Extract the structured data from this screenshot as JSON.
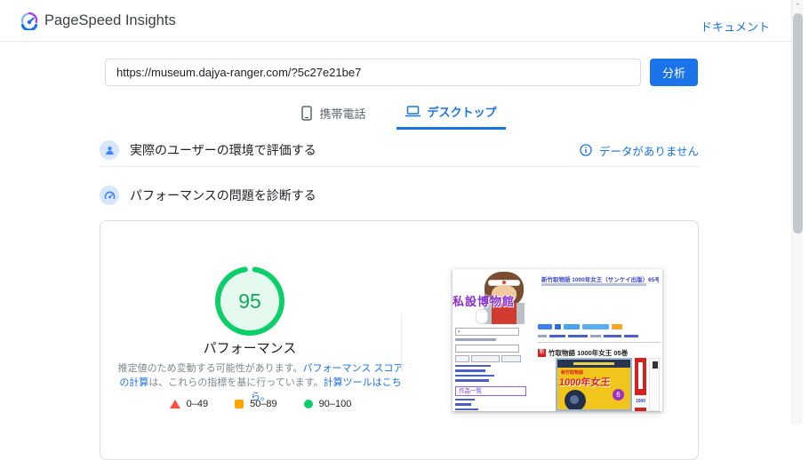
{
  "header": {
    "app_title": "PageSpeed Insights",
    "doc_link": "ドキュメント"
  },
  "analyze": {
    "url_value": "https://museum.dajya-ranger.com/?5c27e21be7",
    "analyze_button": "分析"
  },
  "tabs": [
    {
      "label": "携帯電話",
      "active": false
    },
    {
      "label": "デスクトップ",
      "active": true
    }
  ],
  "sections": {
    "field_data": {
      "title": "実際のユーザーの環境で評価する",
      "status": "データがありません"
    },
    "diagnose": {
      "title": "パフォーマンスの問題を診断する"
    }
  },
  "performance": {
    "score": "95",
    "label": "パフォーマンス",
    "note_part1": "推定値のため変動する可能性があります。",
    "note_link1": "パフォーマンス スコアの計算",
    "note_part2": "は、これらの指標を基に行っています。",
    "note_link2": "計算ツールはこちら。",
    "legend": [
      {
        "range": "0–49",
        "color": "#ff4e42",
        "shape": "triangle"
      },
      {
        "range": "50–89",
        "color": "#ffa400",
        "shape": "square"
      },
      {
        "range": "90–100",
        "color": "#0cce6b",
        "shape": "circle"
      }
    ]
  },
  "thumbnail": {
    "site_name": "私設博物館",
    "page_title": "新竹取物語 1000年女王（サンケイ出版）65号",
    "new_badge": "新",
    "article_heading": "竹取物語 1000年女王 05巻",
    "sidebar_box": "作品一覧",
    "cover_series": "新竹取物語",
    "cover_title": "1000年女王",
    "cover_number": "6",
    "spine_number": "1000"
  },
  "colors": {
    "accent_blue": "#1a73e8",
    "score_green": "#0cce6b",
    "legend_red": "#ff4e42",
    "legend_orange": "#ffa400"
  }
}
